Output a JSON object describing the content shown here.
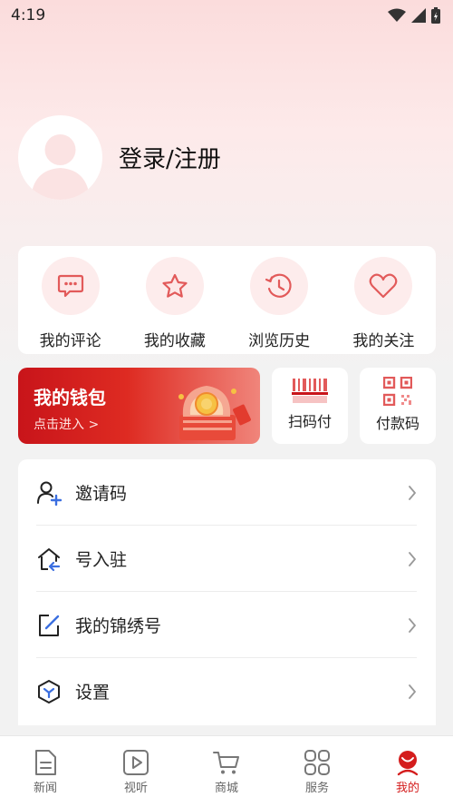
{
  "status_bar": {
    "time": "4:19"
  },
  "profile": {
    "login_text": "登录/注册"
  },
  "quick_actions": [
    {
      "label": "我的评论",
      "icon": "comment-icon"
    },
    {
      "label": "我的收藏",
      "icon": "star-icon"
    },
    {
      "label": "浏览历史",
      "icon": "history-icon"
    },
    {
      "label": "我的关注",
      "icon": "heart-icon"
    }
  ],
  "wallet": {
    "title": "我的钱包",
    "subtitle": "点击进入 >"
  },
  "pay": [
    {
      "label": "扫码付",
      "icon": "scan-icon"
    },
    {
      "label": "付款码",
      "icon": "qrcode-icon"
    }
  ],
  "menu": [
    {
      "label": "邀请码",
      "icon": "invite-user-icon"
    },
    {
      "label": "号入驻",
      "icon": "home-enter-icon"
    },
    {
      "label": "我的锦绣号",
      "icon": "edit-icon"
    },
    {
      "label": "设置",
      "icon": "settings-icon"
    }
  ],
  "tabs": [
    {
      "label": "新闻",
      "icon": "news-icon"
    },
    {
      "label": "视听",
      "icon": "play-icon"
    },
    {
      "label": "商城",
      "icon": "cart-icon"
    },
    {
      "label": "服务",
      "icon": "grid-icon"
    },
    {
      "label": "我的",
      "icon": "mine-icon",
      "active": true
    }
  ],
  "colors": {
    "accent": "#d41d1d",
    "icon_red": "#e25a5a",
    "quick_bg": "#fdecec"
  }
}
